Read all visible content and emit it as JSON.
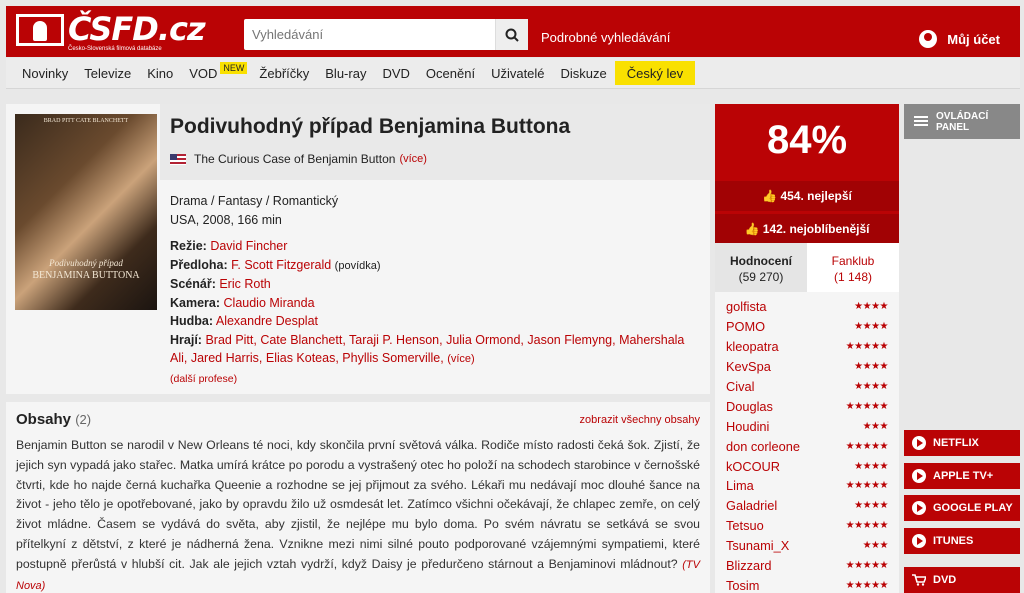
{
  "header": {
    "logo_text": "ČSFD.cz",
    "logo_sub": "Česko-Slovenská filmová databáze",
    "search_placeholder": "Vyhledávání",
    "advanced_search": "Podrobné vyhledávání",
    "account": "Můj účet"
  },
  "nav": {
    "items": [
      "Novinky",
      "Televize",
      "Kino",
      "VOD",
      "Žebříčky",
      "Blu-ray",
      "DVD",
      "Ocenění",
      "Uživatelé",
      "Diskuze",
      "Český lev"
    ],
    "vod_badge": "NEW"
  },
  "film": {
    "poster": {
      "top": "BRAD PITT   CATE BLANCHETT",
      "title1": "Podivuhodný případ",
      "title2": "BENJAMINA BUTTONA"
    },
    "title": "Podivuhodný případ Benjamina Buttona",
    "original_title": "The Curious Case of Benjamin Button",
    "more": "(více)",
    "genres": "Drama / Fantasy / Romantický",
    "origin": "USA, 2008, 166 min",
    "director_label": "Režie:",
    "director": "David Fincher",
    "source_label": "Předloha:",
    "source": "F. Scott Fitzgerald",
    "source_note": "(povídka)",
    "screenplay_label": "Scénář:",
    "screenplay": "Eric Roth",
    "camera_label": "Kamera:",
    "camera": "Claudio Miranda",
    "music_label": "Hudba:",
    "music": "Alexandre Desplat",
    "cast_label": "Hrají:",
    "cast_line1": "Brad Pitt, Cate Blanchett, Taraji P. Henson, Julia Ormond, Jason Flemyng, Mahershala",
    "cast_line2": "Ali, Jared Harris, Elias Koteas, Phyllis Somerville,",
    "cast_more": "(více)",
    "more_professions": "(další profese)"
  },
  "plot": {
    "heading": "Obsahy",
    "count": "(2)",
    "show_all": "zobrazit všechny obsahy",
    "text": "Benjamin Button se narodil v New Orleans té noci, kdy skončila první světová válka. Rodiče místo radosti čeká šok. Zjistí, že jejich syn vypadá jako stařec. Matka umírá krátce po porodu a vystrašený otec ho položí na schodech starobince v černošské čtvrti, kde ho najde černá kuchařka Queenie a rozhodne se jej přijmout za svého. Lékaři mu nedávají moc dlouhé šance na život - jeho tělo je opotřebované, jako by opravdu žilo už osmdesát let. Zatímco všichni očekávají, že chlapec zemře, on celý život mládne. Časem se vydává do světa, aby zjistil, že nejlépe mu bylo doma. Po svém návratu se setkává se svou přítelkyní z dětství, z které je nádherná žena. Vznikne mezi nimi silné pouto podporované vzájemnými sympatiemi, které postupně přerůstá v hlubší cit. Jak ale jejich vztah vydrží, když Daisy je předurčeno stárnout a Benjaminovi mládnout?",
    "source": "(TV Nova)"
  },
  "rating": {
    "percent": "84%",
    "best": "454. nejlepší",
    "favorite": "142. nejoblíbenější",
    "tab_ratings": "Hodnocení",
    "tab_ratings_count": "(59 270)",
    "tab_fanclub": "Fanklub",
    "tab_fanclub_count": "(1 148)",
    "users": [
      {
        "name": "golfista",
        "stars": "★★★★"
      },
      {
        "name": "POMO",
        "stars": "★★★★"
      },
      {
        "name": "kleopatra",
        "stars": "★★★★★"
      },
      {
        "name": "KevSpa",
        "stars": "★★★★"
      },
      {
        "name": "Cival",
        "stars": "★★★★"
      },
      {
        "name": "Douglas",
        "stars": "★★★★★"
      },
      {
        "name": "Houdini",
        "stars": "★★★"
      },
      {
        "name": "don corleone",
        "stars": "★★★★★"
      },
      {
        "name": "kOCOUR",
        "stars": "★★★★"
      },
      {
        "name": "Lima",
        "stars": "★★★★★"
      },
      {
        "name": "Galadriel",
        "stars": "★★★★"
      },
      {
        "name": "Tetsuo",
        "stars": "★★★★★"
      },
      {
        "name": "Tsunami_X",
        "stars": "★★★"
      },
      {
        "name": "Blizzard",
        "stars": "★★★★★"
      },
      {
        "name": "Tosim",
        "stars": "★★★★★"
      }
    ]
  },
  "sidebar": {
    "panel_line1": "OVLÁDACÍ",
    "panel_line2": "PANEL",
    "vod": [
      "NETFLIX",
      "APPLE TV+",
      "GOOGLE PLAY",
      "ITUNES"
    ],
    "dvd": "DVD"
  },
  "colors": {
    "brand": "#ba0305",
    "accent": "#f9e000"
  }
}
